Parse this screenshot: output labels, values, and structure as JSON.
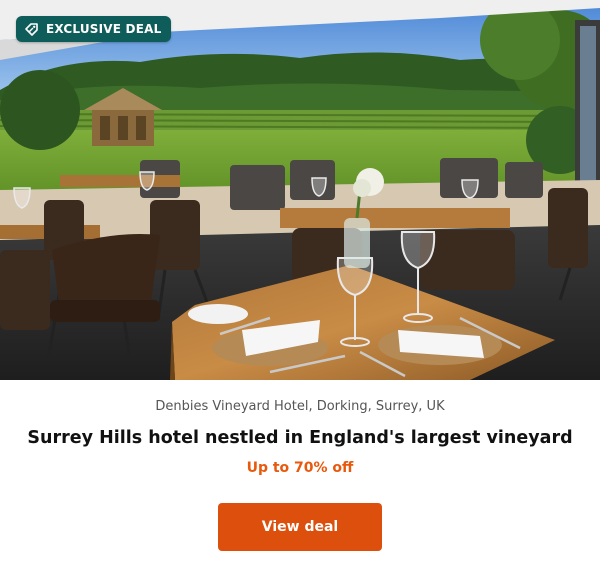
{
  "badge": {
    "icon": "percent-tag-icon",
    "label": "EXCLUSIVE DEAL",
    "color": "#0f5d5a"
  },
  "hero": {
    "image_description_icon": "restaurant-terrace-photo"
  },
  "deal": {
    "location": "Denbies Vineyard Hotel, Dorking, Surrey, UK",
    "title": "Surrey Hills hotel nestled in England's largest vineyard",
    "discount": "Up to 70% off",
    "cta_label": "View deal"
  },
  "colors": {
    "accent": "#dd4f0c",
    "discount_text": "#e8590c",
    "badge_bg": "#0f5d5a"
  }
}
